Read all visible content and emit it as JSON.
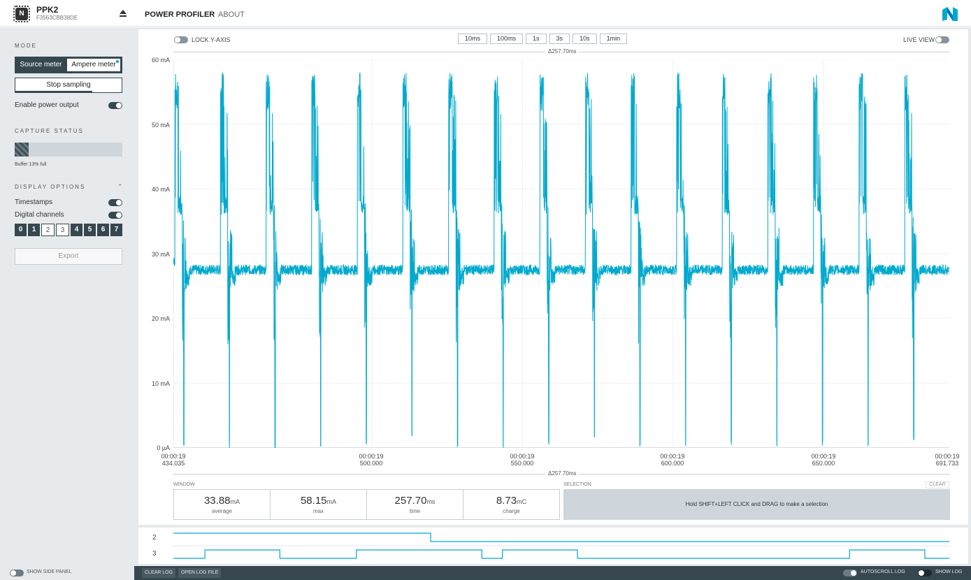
{
  "device": {
    "name": "PPK2",
    "serial": "F3563CBB38DE"
  },
  "nav": {
    "tabs": [
      "POWER PROFILER",
      "ABOUT"
    ]
  },
  "sidebar": {
    "mode_title": "MODE",
    "mode_options": [
      "Source meter",
      "Ampere meter"
    ],
    "stop_sampling": "Stop sampling",
    "enable_power_output": "Enable power output",
    "capture_status_title": "CAPTURE STATUS",
    "buffer_label": "Buffer 13% full",
    "buffer_fill_fraction": 0.13,
    "display_options_title": "DISPLAY OPTIONS",
    "timestamps_label": "Timestamps",
    "digital_channels_label": "Digital channels",
    "channels": [
      {
        "label": "0",
        "on": true
      },
      {
        "label": "1",
        "on": true
      },
      {
        "label": "2",
        "on": false
      },
      {
        "label": "3",
        "on": false
      },
      {
        "label": "4",
        "on": true
      },
      {
        "label": "5",
        "on": true
      },
      {
        "label": "6",
        "on": true
      },
      {
        "label": "7",
        "on": true
      }
    ],
    "export": "Export"
  },
  "chart_toolbar": {
    "lock_y_axis": "LOCK Y-AXIS",
    "window_buttons": [
      "10ms",
      "100ms",
      "1s",
      "3s",
      "10s",
      "1min"
    ],
    "live_view": "LIVE VIEW",
    "delta_top": "Δ257.70ms",
    "delta_bottom": "Δ257.70ms"
  },
  "chart_data": {
    "type": "line",
    "ylabel": "",
    "y_ticks": [
      "60 mA",
      "50 mA",
      "40 mA",
      "30 mA",
      "20 mA",
      "10 mA",
      "0 µA"
    ],
    "ylim": [
      0,
      60
    ],
    "x_ticks": [
      {
        "line1": "00:00:19",
        "line2": "434.035"
      },
      {
        "line1": "00:00:19",
        "line2": "500.000"
      },
      {
        "line1": "00:00:19",
        "line2": "550.000"
      },
      {
        "line1": "00:00:19",
        "line2": "600.000"
      },
      {
        "line1": "00:00:19",
        "line2": "650.000"
      },
      {
        "line1": "00:00:19",
        "line2": "691.733"
      }
    ],
    "xlim_ms": [
      434.035,
      691.733
    ],
    "series": [
      {
        "color": "#00a9ce",
        "burst_period_ms": 15.15,
        "burst_peak_mA": 57.5,
        "baseline_mA": 27.5,
        "burst_count": 17
      }
    ]
  },
  "stats": {
    "window_title": "WINDOW",
    "items": [
      {
        "value": "33.88",
        "unit": "mA",
        "label": "average"
      },
      {
        "value": "58.15",
        "unit": "mA",
        "label": "max"
      },
      {
        "value": "257.70",
        "unit": "ms",
        "label": "time"
      },
      {
        "value": "8.73",
        "unit": "mC",
        "label": "charge"
      }
    ],
    "selection_title": "SELECTION",
    "selection_hint": "Hold SHIFT+LEFT CLICK and DRAG to make a selection",
    "clear": "CLEAR"
  },
  "digital": {
    "channels": [
      {
        "label": "2",
        "transitions_ms": [
          [
            434.035,
            1
          ],
          [
            519.5,
            0
          ]
        ]
      },
      {
        "label": "3",
        "transitions_ms": [
          [
            434.035,
            0
          ],
          [
            444.5,
            1
          ],
          [
            469.4,
            0
          ],
          [
            494.8,
            1
          ],
          [
            536.5,
            0
          ],
          [
            543.3,
            1
          ],
          [
            568.2,
            0
          ],
          [
            658.6,
            1
          ],
          [
            683.6,
            0
          ]
        ]
      }
    ]
  },
  "footer": {
    "show_side_panel": "SHOW SIDE PANEL",
    "clear_log": "CLEAR LOG",
    "open_log_file": "OPEN LOG FILE",
    "autoscroll_log": "AUTOSCROLL LOG",
    "show_log": "SHOW LOG"
  },
  "colors": {
    "accent": "#00a9ce",
    "dark": "#37474f",
    "panel": "#e6eaed"
  }
}
